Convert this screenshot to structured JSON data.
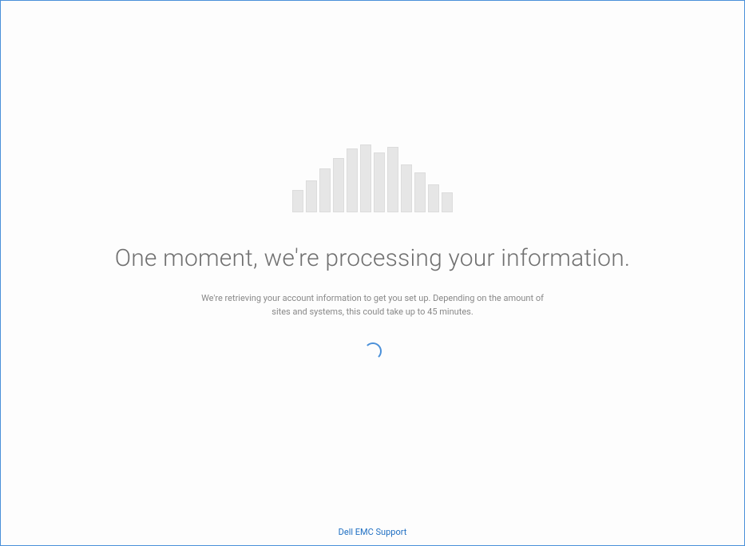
{
  "page": {
    "heading": "One moment, we're processing your information.",
    "subtext": "We're retrieving your account information to get you set up. Depending on the amount of sites and systems, this could take up to 45 minutes.",
    "footer_link": "Dell EMC Support"
  },
  "icons": {
    "cloud_bars": "cloud-bars-icon",
    "spinner": "loading-spinner-icon"
  },
  "colors": {
    "border": "#4a90d9",
    "heading": "#707070",
    "subtext": "#888888",
    "link": "#1f6fc2",
    "bar_fill": "#e6e6e6"
  }
}
